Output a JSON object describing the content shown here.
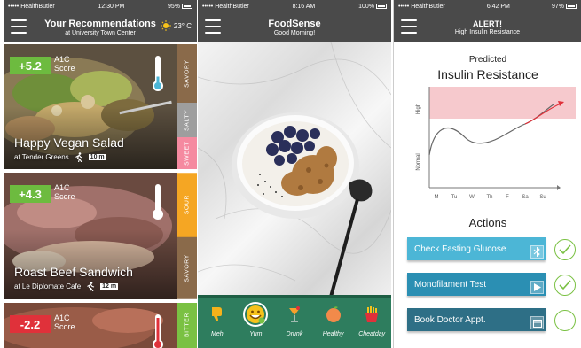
{
  "status_bar": {
    "s1": {
      "carrier": "••••• HealthButler",
      "time": "12:30 PM",
      "battery": "95%"
    },
    "s2": {
      "carrier": "••••• HealthButler",
      "time": "8:16 AM",
      "battery": "100%"
    },
    "s3": {
      "carrier": "••••• HealthButler",
      "time": "6:42 PM",
      "battery": "97%"
    }
  },
  "screen1": {
    "title": "Your Recommendations",
    "subtitle": "at University Town Center",
    "temperature": "23° C",
    "cards": [
      {
        "score": "+5.2",
        "score_label_1": "A1C",
        "score_label_2": "Score",
        "name": "Happy Vegan Salad",
        "location": "at Tender Greens",
        "distance": "10 m",
        "tags": [
          "SAVORY",
          "SALTY",
          "SWEET"
        ],
        "thermo_level": 0.25
      },
      {
        "score": "+4.3",
        "score_label_1": "A1C",
        "score_label_2": "Score",
        "name": "Roast Beef Sandwich",
        "location": "at Le Diplomate Cafe",
        "distance": "12 m",
        "tags": [
          "SOUR",
          "SAVORY"
        ],
        "thermo_level": 0.1
      },
      {
        "score": "-2.2",
        "score_label_1": "A1C",
        "score_label_2": "Score",
        "name": "",
        "location": "",
        "distance": "",
        "tags": [
          "BITTER"
        ],
        "thermo_level": 0.9
      }
    ]
  },
  "screen2": {
    "title": "FoodSense",
    "subtitle": "Good Morning!",
    "moods": [
      {
        "label": "Meh",
        "icon": "thumbs-down-icon"
      },
      {
        "label": "Yum",
        "icon": "smiley-icon"
      },
      {
        "label": "Drunk",
        "icon": "cocktail-icon"
      },
      {
        "label": "Healthy",
        "icon": "peach-icon"
      },
      {
        "label": "Cheatday",
        "icon": "fries-icon"
      }
    ]
  },
  "screen3": {
    "title": "ALERT!",
    "subtitle": "High Insulin Resistance",
    "predicted": "Predicted",
    "heading": "Insulin Resistance",
    "chart_labels": {
      "high": "High",
      "normal": "Normal"
    },
    "days": [
      "M",
      "Tu",
      "W",
      "Th",
      "F",
      "Sa",
      "Su"
    ],
    "actions_title": "Actions",
    "actions": [
      {
        "label": "Check Fasting Glucose",
        "icon": "bluetooth-icon",
        "done": true
      },
      {
        "label": "Monofilament Test",
        "icon": "play-icon",
        "done": true
      },
      {
        "label": "Book Doctor Appt.",
        "icon": "calendar-icon",
        "done": false
      }
    ]
  },
  "colors": {
    "bar": "#4a4a4a",
    "green": "#6dbb3f",
    "red": "#e0313a",
    "savory": "#8a6a4a",
    "salty": "#9e9e9e",
    "sweet": "#f58aa0",
    "sour": "#f5a623",
    "bitter": "#7ac143",
    "mood_bg": "#2e7d5e",
    "action1": "#4cb6d6",
    "action2": "#2b8fb3",
    "action3": "#2e6f86",
    "check": "#7ac143",
    "chart_arrow": "#e0313a",
    "high_zone": "#f6c9cd"
  }
}
